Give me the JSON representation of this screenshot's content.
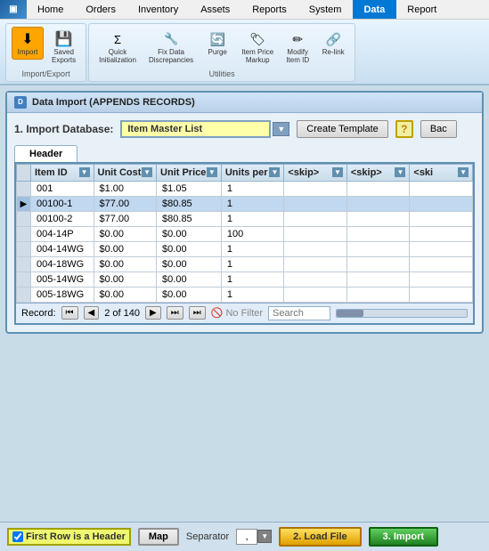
{
  "topnav": {
    "items": [
      {
        "label": "Home",
        "active": false
      },
      {
        "label": "Orders",
        "active": false
      },
      {
        "label": "Inventory",
        "active": false
      },
      {
        "label": "Assets",
        "active": false
      },
      {
        "label": "Reports",
        "active": false
      },
      {
        "label": "System",
        "active": false
      },
      {
        "label": "Data",
        "active": true
      },
      {
        "label": "Report",
        "active": false
      }
    ]
  },
  "ribbon": {
    "groups": [
      {
        "label": "Import/Export",
        "buttons": [
          {
            "label": "Import",
            "icon": "⬇",
            "active": true
          },
          {
            "label": "Saved\nExports",
            "icon": "💾",
            "active": false
          }
        ]
      },
      {
        "label": "Utilities",
        "buttons": [
          {
            "label": "Quick\nInitialization",
            "icon": "⚡",
            "active": false
          },
          {
            "label": "Fix Data\nDiscrepancies",
            "icon": "🔧",
            "active": false
          },
          {
            "label": "Purge",
            "icon": "🔄",
            "active": false
          },
          {
            "label": "Item Price\nMarkup",
            "icon": "🏷",
            "active": false
          },
          {
            "label": "Modify\nItem ID",
            "icon": "✏",
            "active": false
          },
          {
            "label": "Re-link",
            "icon": "🔗",
            "active": false
          }
        ]
      }
    ]
  },
  "dialog": {
    "title": "Data Import (APPENDS RECORDS)",
    "import_label": "1. Import Database:",
    "import_value": "Item Master List",
    "create_template_label": "Create Template",
    "back_label": "Bac",
    "header_tab": "Header",
    "columns": [
      {
        "label": "Item ID",
        "sortable": true
      },
      {
        "label": "Unit Cost",
        "sortable": true
      },
      {
        "label": "Unit Price",
        "sortable": true
      },
      {
        "label": "Units per",
        "sortable": true
      },
      {
        "label": "<skip>",
        "sortable": true
      },
      {
        "label": "<skip>",
        "sortable": true
      },
      {
        "label": "<ski",
        "sortable": true
      }
    ],
    "rows": [
      {
        "active": false,
        "arrow": false,
        "id": "001",
        "unit_cost": "$1.00",
        "unit_price": "$1.05",
        "units_per": "1",
        "s1": "",
        "s2": "",
        "s3": ""
      },
      {
        "active": true,
        "arrow": true,
        "id": "00100-1",
        "unit_cost": "$77.00",
        "unit_price": "$80.85",
        "units_per": "1",
        "s1": "",
        "s2": "",
        "s3": ""
      },
      {
        "active": false,
        "arrow": false,
        "id": "00100-2",
        "unit_cost": "$77.00",
        "unit_price": "$80.85",
        "units_per": "1",
        "s1": "",
        "s2": "",
        "s3": ""
      },
      {
        "active": false,
        "arrow": false,
        "id": "004-14P",
        "unit_cost": "$0.00",
        "unit_price": "$0.00",
        "units_per": "100",
        "s1": "",
        "s2": "",
        "s3": ""
      },
      {
        "active": false,
        "arrow": false,
        "id": "004-14WG",
        "unit_cost": "$0.00",
        "unit_price": "$0.00",
        "units_per": "1",
        "s1": "",
        "s2": "",
        "s3": ""
      },
      {
        "active": false,
        "arrow": false,
        "id": "004-18WG",
        "unit_cost": "$0.00",
        "unit_price": "$0.00",
        "units_per": "1",
        "s1": "",
        "s2": "",
        "s3": ""
      },
      {
        "active": false,
        "arrow": false,
        "id": "005-14WG",
        "unit_cost": "$0.00",
        "unit_price": "$0.00",
        "units_per": "1",
        "s1": "",
        "s2": "",
        "s3": ""
      },
      {
        "active": false,
        "arrow": false,
        "id": "005-18WG",
        "unit_cost": "$0.00",
        "unit_price": "$0.00",
        "units_per": "1",
        "s1": "",
        "s2": "",
        "s3": ""
      }
    ],
    "record_nav": {
      "label": "Record:",
      "first": "⏮",
      "prev": "◀",
      "current": "2 of 140",
      "next": "▶",
      "last": "⏭",
      "end": "⏭",
      "filter": "No Filter",
      "search_placeholder": "Search"
    }
  },
  "bottom_bar": {
    "checkbox_label": "First Row is a Header",
    "map_label": "Map",
    "separator_label": "Separator",
    "separator_value": ",",
    "load_label": "2. Load File",
    "import_label": "3. Import"
  }
}
